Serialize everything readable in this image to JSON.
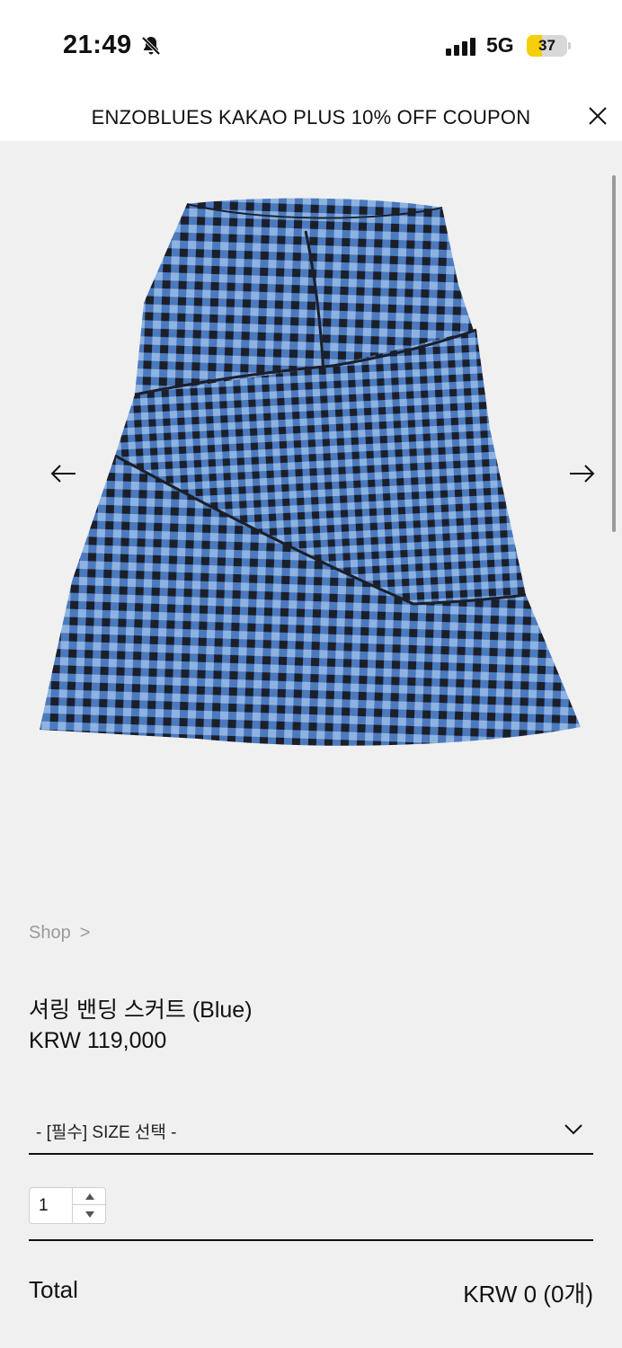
{
  "status_bar": {
    "time": "21:49",
    "network": "5G",
    "battery": "37",
    "battery_level": 0.37,
    "battery_color": "#f5cf0a"
  },
  "banner": {
    "text": "ENZOBLUES KAKAO PLUS 10% OFF COUPON",
    "close_icon": "close-icon"
  },
  "gallery": {
    "prev_icon": "arrow-left-icon",
    "next_icon": "arrow-right-icon",
    "image_description_icon": "skirt-image"
  },
  "breadcrumb": {
    "shop_label": "Shop",
    "separator": ">"
  },
  "product": {
    "name": "셔링 밴딩 스커트 (Blue)",
    "price": "KRW 119,000"
  },
  "size_select": {
    "selected": "- [필수] SIZE 선택 -",
    "icon": "chevron-down-icon"
  },
  "quantity": {
    "value": "1"
  },
  "total": {
    "label": "Total",
    "value": "KRW 0 (0개)"
  },
  "colors": {
    "background": "#f0f0f1",
    "accent_text": "#111111",
    "muted_text": "#9a9a9a",
    "skirt_blue": "#3f6fb8",
    "skirt_dark": "#1b1f2a"
  }
}
